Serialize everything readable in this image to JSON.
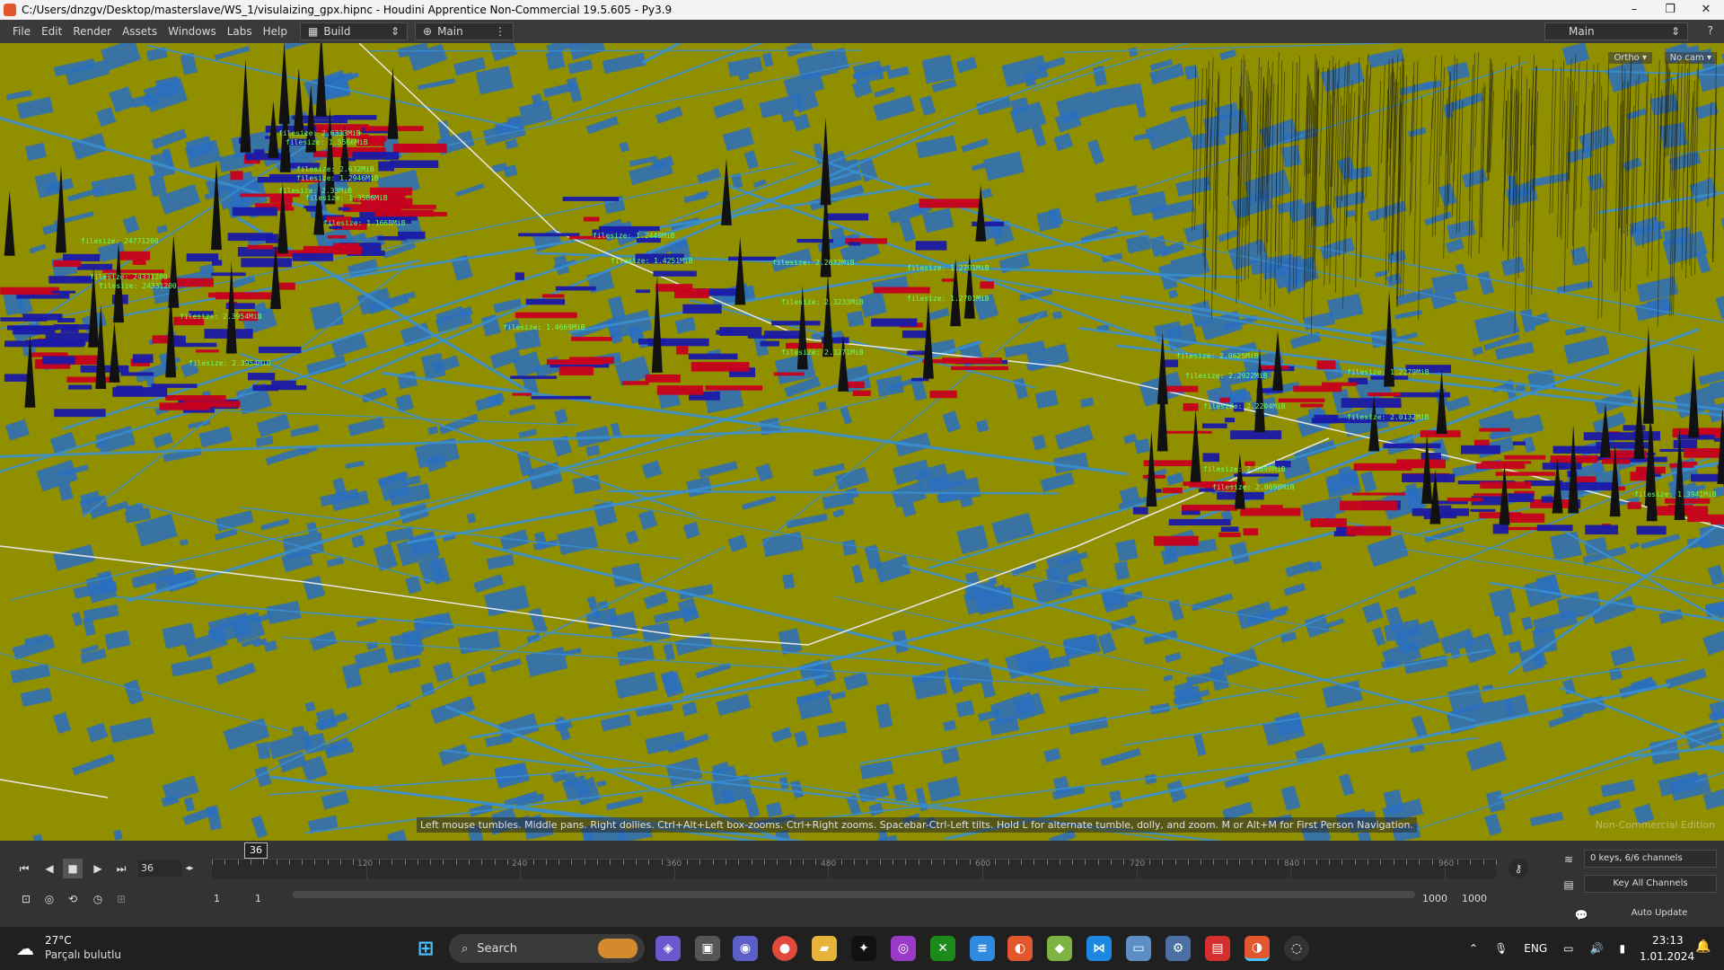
{
  "window": {
    "title": "C:/Users/dnzgv/Desktop/masterslave/WS_1/visulaizing_gpx.hipnc - Houdini Apprentice Non-Commercial 19.5.605 - Py3.9",
    "minimize": "–",
    "maximize": "❐",
    "close": "✕"
  },
  "menu": {
    "items": [
      "File",
      "Edit",
      "Render",
      "Assets",
      "Windows",
      "Labs",
      "Help"
    ],
    "desktop_build": "Build",
    "desktop_main": "Main",
    "right_desktop": "Main"
  },
  "viewport": {
    "camera_menu": "Ortho ▾",
    "cam_menu": "No cam ▾",
    "hint": "Left mouse tumbles. Middle pans. Right dollies. Ctrl+Alt+Left box-zooms. Ctrl+Right zooms. Spacebar-Ctrl-Left tilts. Hold L for alternate tumble, dolly, and zoom.    M or Alt+M for First Person Navigation.",
    "watermark": "Non-Commercial Edition",
    "labels": [
      "filesize: 2.6333MiB",
      "filesize: 1.5566MiB",
      "filesize: 2.632MiB",
      "filesize: 1.2946MiB",
      "filesize: 2.33MiB",
      "filesize: 1.3566MiB",
      "filesize: 1.1668MiB",
      "filesize: 24771200",
      "filesize: 24331200",
      "filesize: 24331200",
      "filesize: 2.3954MiB",
      "filesize: 2.3954MiB",
      "filesize: 1.4669MiB",
      "filesize: 1.2449MiB",
      "filesize: 1.4251MiB",
      "filesize: 2.2632MiB",
      "filesize: 1.2701MiB",
      "filesize: 2.3233MiB",
      "filesize: 1.2701MiB",
      "filesize: 2.3271MiB",
      "filesize: 2.0625MiB",
      "filesize: 2.2922MiB",
      "filesize: 2.2204MiB",
      "filesize: 1.2279MiB",
      "filesize: 2.0698MiB",
      "filesize: 2.0698MiB",
      "filesize: 2.0132MiB",
      "filesize: 1.3941MiB"
    ]
  },
  "timeline": {
    "current_frame": "36",
    "cursor_frame": "36",
    "tick_labels": [
      "120",
      "240",
      "360",
      "480",
      "600",
      "720",
      "840",
      "960"
    ],
    "start_frame": "1",
    "start_frame2": "1",
    "end_frame": "1000",
    "end_frame2": "1000",
    "keys_info": "0 keys, 6/6 channels",
    "key_all": "Key All Channels",
    "auto_update": "Auto Update"
  },
  "taskbar": {
    "weather_temp": "27°C",
    "weather_desc": "Parçalı bulutlu",
    "search_label": "Search",
    "language": "ENG",
    "time": "23:13",
    "date": "1.01.2024"
  },
  "colors": {
    "ground": "#8f8f00",
    "buildings": "#2a6fc0",
    "streets": "#3a8fd0",
    "label": "#6bff6b",
    "bars_red": "#c8001e",
    "bars_blue": "#1a1aa8"
  }
}
